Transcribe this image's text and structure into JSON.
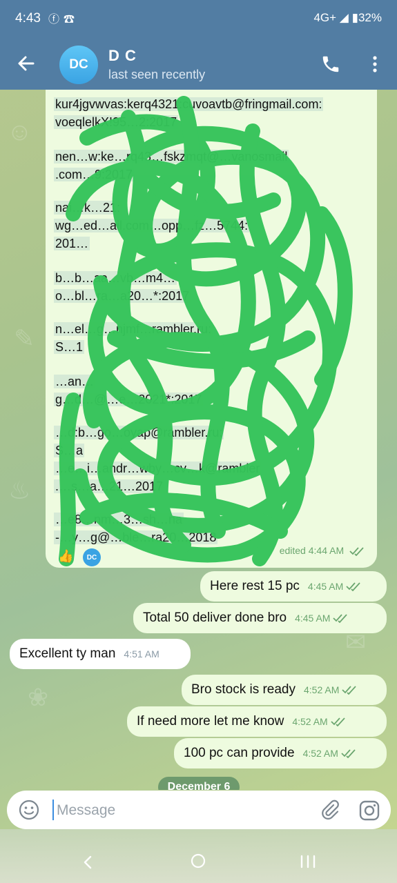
{
  "status_bar": {
    "time": "4:43",
    "icons": [
      "facebook-icon",
      "viber-icon"
    ],
    "network": "4G+",
    "battery": "32%"
  },
  "header": {
    "avatar_initials": "DC",
    "name": "D C",
    "status": "last seen recently"
  },
  "big_message": {
    "lines": [
      "kur4jgvwvas:kerq4321:cuvoavtb@fringmail.com:",
      "voeqlelkX!95…2:2017",
      "nen…w:ke…rq43…fskzmqt@…vanosmail",
      ".com…9:2017",
      "nai…k…21:",
      "wg…ed…ail.com…opp…fz…5744:",
      "201…",
      "b…b…aa…vb…m4…",
      "o…bl…ra…a20…*:2017",
      "n…el…g…njmf…rambler.ru:",
      "S…1",
      "…an…",
      "g…d…@…e…2021*:2017",
      "…d:b…go…oyap@rambler.ru:",
      "S…a",
      "…e…i…andr…wby…cv…k@rambler",
      ".…s…a…21…2017",
      "…e8…nm…3…sh…na",
      "-…y…g@…ble…ra20…2018"
    ],
    "reaction_emoji": "👍",
    "reaction_avatar": "DC",
    "meta": "edited 4:44 AM"
  },
  "messages": [
    {
      "direction": "out",
      "text": "Here rest 15 pc",
      "time": "4:45 AM",
      "read": true
    },
    {
      "direction": "out",
      "text": "Total 50 deliver done bro",
      "time": "4:45 AM",
      "read": true
    },
    {
      "direction": "in",
      "text": "Excellent ty man",
      "time": "4:51 AM"
    },
    {
      "direction": "out",
      "text": "Bro stock is ready",
      "time": "4:52 AM",
      "read": true
    },
    {
      "direction": "out",
      "text": "If need more let me know",
      "time": "4:52 AM",
      "read": true
    },
    {
      "direction": "out",
      "text": "100 pc can provide",
      "time": "4:52 AM",
      "read": true
    }
  ],
  "date_divider": "December 6",
  "input": {
    "placeholder": "Message",
    "value": ""
  },
  "colors": {
    "header": "#527da3",
    "outgoing_bubble": "#eefbdf",
    "incoming_bubble": "#ffffff",
    "scribble": "#35c45a",
    "meta_green": "#6ba66f"
  }
}
